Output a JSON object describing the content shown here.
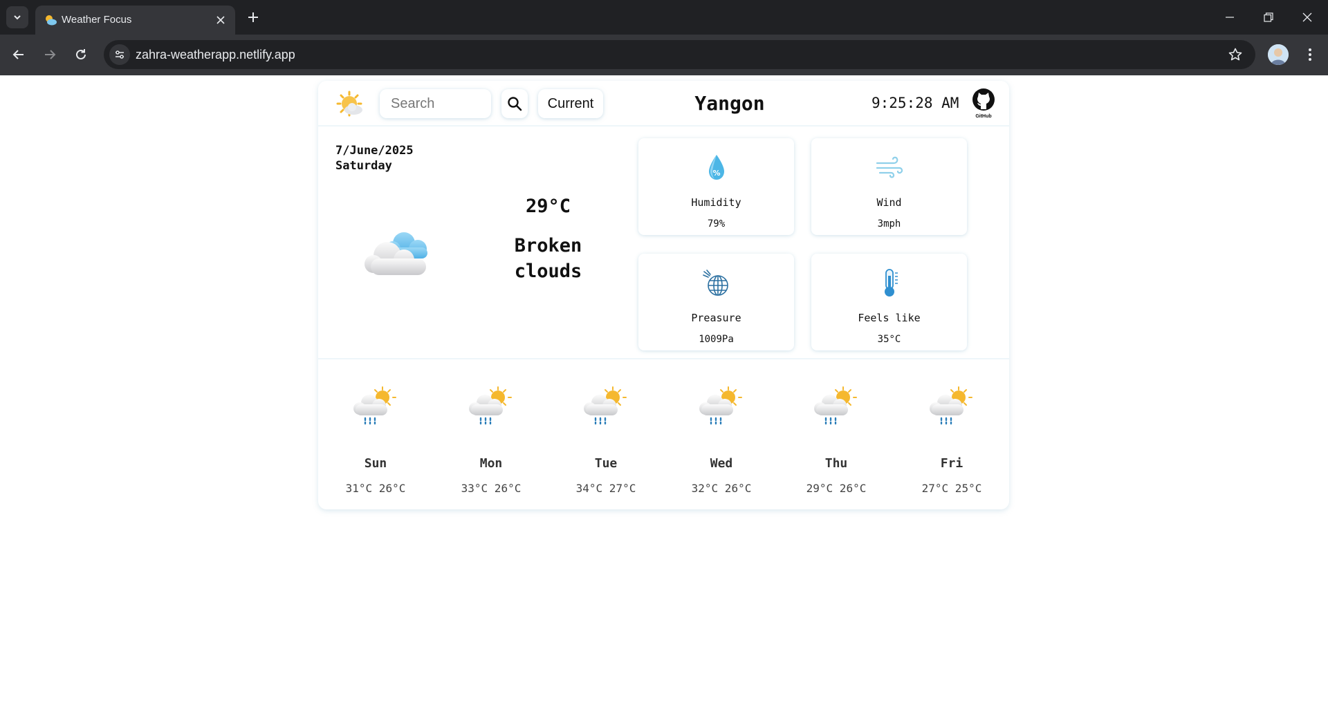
{
  "browser": {
    "tab_title": "Weather Focus",
    "url": "zahra-weatherapp.netlify.app"
  },
  "header": {
    "search_placeholder": "Search",
    "current_label": "Current",
    "city": "Yangon",
    "time": "9:25:28 AM",
    "github_label": "GitHub"
  },
  "current": {
    "date": "7/June/2025",
    "weekday": "Saturday",
    "temperature": "29°C",
    "condition_line1": "Broken",
    "condition_line2": "clouds",
    "condition_icon": "broken-clouds-icon"
  },
  "stats": [
    {
      "label": "Humidity",
      "value": "79%",
      "icon": "humidity-drop-icon"
    },
    {
      "label": "Wind",
      "value": "3mph",
      "icon": "wind-icon"
    },
    {
      "label": "Preasure",
      "value": "1009Pa",
      "icon": "pressure-globe-icon"
    },
    {
      "label": "Feels like",
      "value": "35°C",
      "icon": "thermometer-icon"
    }
  ],
  "forecast": [
    {
      "day": "Sun",
      "temps": "31°C 26°C",
      "icon": "rain-sun-cloud-icon"
    },
    {
      "day": "Mon",
      "temps": "33°C 26°C",
      "icon": "rain-sun-cloud-icon"
    },
    {
      "day": "Tue",
      "temps": "34°C 27°C",
      "icon": "rain-sun-cloud-icon"
    },
    {
      "day": "Wed",
      "temps": "32°C 26°C",
      "icon": "rain-sun-cloud-icon"
    },
    {
      "day": "Thu",
      "temps": "29°C 26°C",
      "icon": "rain-sun-cloud-icon"
    },
    {
      "day": "Fri",
      "temps": "27°C 25°C",
      "icon": "rain-sun-cloud-icon"
    }
  ],
  "colors": {
    "chrome_dark": "#202124",
    "chrome_mid": "#35363a",
    "sun": "#f5b82e",
    "cloud_blue": "#5ab8ec",
    "rain": "#2a7db8",
    "card_shadow": "#96bed2"
  }
}
